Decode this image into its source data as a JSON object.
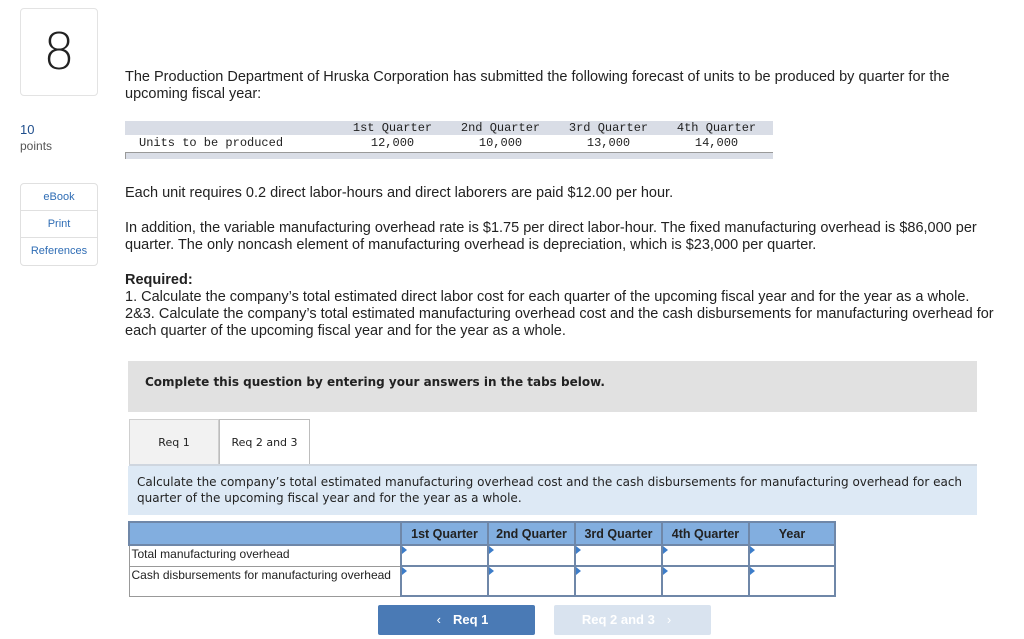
{
  "question": {
    "number": "8",
    "points_value": "10",
    "points_label": "points"
  },
  "side_links": [
    {
      "label": "eBook"
    },
    {
      "label": "Print"
    },
    {
      "label": "References"
    }
  ],
  "problem": {
    "intro": "The Production Department of Hruska Corporation has submitted the following forecast of units to be produced by quarter for the upcoming fiscal year:",
    "units_table": {
      "headers": [
        "1st Quarter",
        "2nd Quarter",
        "3rd Quarter",
        "4th Quarter"
      ],
      "row_label": "Units to be produced",
      "values": [
        "12,000",
        "10,000",
        "13,000",
        "14,000"
      ]
    },
    "para1": "Each unit requires 0.2 direct labor-hours and direct laborers are paid $12.00 per hour.",
    "para2": "In addition, the variable manufacturing overhead rate is $1.75 per direct labor-hour. The fixed manufacturing overhead is $86,000 per quarter. The only noncash element of manufacturing overhead is depreciation, which is $23,000 per quarter.",
    "required_title": "Required:",
    "required_1": "1. Calculate the company’s total estimated direct labor cost for each quarter of the upcoming fiscal year and for the year as a whole.",
    "required_23": "2&3. Calculate the company’s total estimated manufacturing overhead cost and the cash disbursements for manufacturing overhead for each quarter of the upcoming fiscal year and for the year as a whole."
  },
  "complete_box": "Complete this question by entering your answers in the tabs below.",
  "tabs": [
    {
      "label": "Req 1",
      "active": false
    },
    {
      "label": "Req 2 and 3",
      "active": true
    }
  ],
  "instruction": "Calculate the company’s total estimated manufacturing overhead cost and the cash disbursements for manufacturing overhead for each quarter of the upcoming fiscal year and for the year as a whole.",
  "answer_table": {
    "headers": [
      "",
      "1st Quarter",
      "2nd Quarter",
      "3rd Quarter",
      "4th Quarter",
      "Year"
    ],
    "rows": [
      {
        "label": "Total manufacturing overhead",
        "values": [
          "",
          "",
          "",
          "",
          ""
        ]
      },
      {
        "label": "Cash disbursements for manufacturing overhead",
        "values": [
          "",
          "",
          "",
          "",
          ""
        ]
      }
    ]
  },
  "nav": {
    "prev_label": "Req 1",
    "next_label": "Req 2 and 3",
    "prev_icon": "chevron-left-icon",
    "next_icon": "chevron-right-icon"
  },
  "colors": {
    "accent": "#4a7ab5",
    "header_blue": "#82aedf",
    "instruction_bg": "#dde9f5"
  }
}
